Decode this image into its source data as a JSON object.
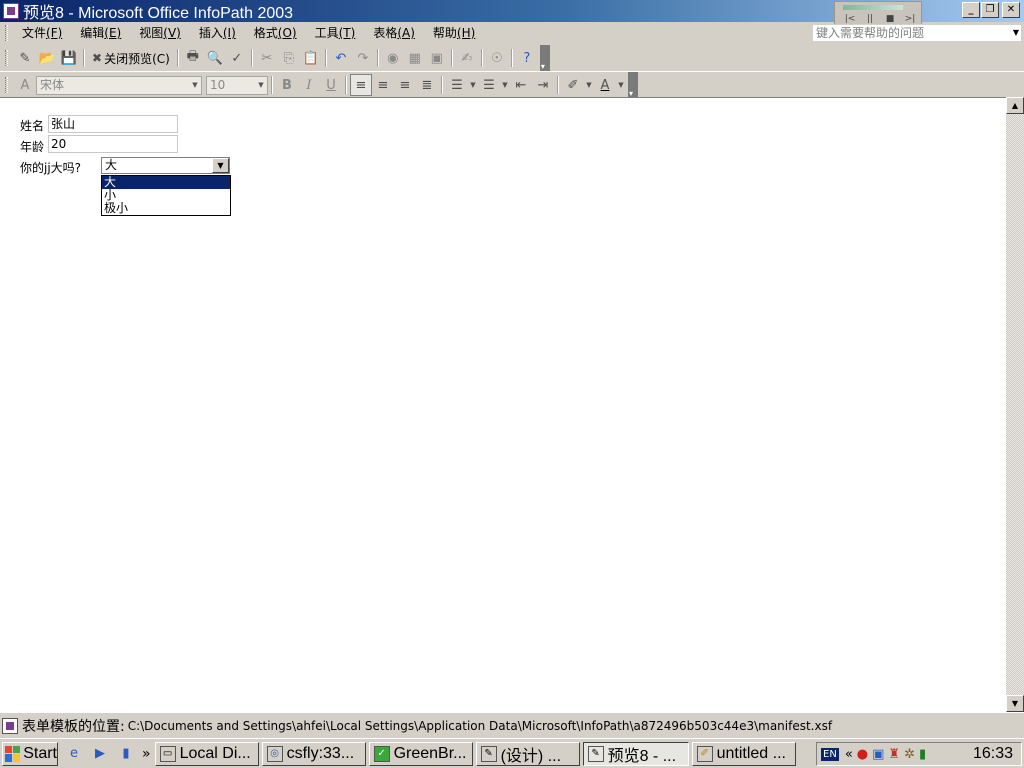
{
  "window": {
    "title": "预览8 - Microsoft Office InfoPath 2003",
    "minimize": "_",
    "restore": "❐",
    "close": "✕"
  },
  "mini_player": {
    "prev": "|<",
    "pause": "||",
    "stop": "■",
    "next": ">|"
  },
  "menubar": {
    "items": [
      {
        "label": "文件",
        "accel": "(F)"
      },
      {
        "label": "编辑",
        "accel": "(E)"
      },
      {
        "label": "视图",
        "accel": "(V)"
      },
      {
        "label": "插入",
        "accel": "(I)"
      },
      {
        "label": "格式",
        "accel": "(O)"
      },
      {
        "label": "工具",
        "accel": "(T)"
      },
      {
        "label": "表格",
        "accel": "(A)"
      },
      {
        "label": "帮助",
        "accel": "(H)"
      }
    ],
    "help_placeholder": "键入需要帮助的问题"
  },
  "toolbar": {
    "close_preview_label": "关闭预览(C)",
    "font_name": "宋体",
    "font_size": "10"
  },
  "form": {
    "name_label": "姓名",
    "name_value": "张山",
    "age_label": "年龄",
    "age_value": "20",
    "question_label": "你的jj大吗?",
    "selected_value": "大",
    "options": [
      "大",
      "小",
      "极小"
    ]
  },
  "statusbar": {
    "label": "表单模板的位置:",
    "path": "C:\\Documents and Settings\\ahfei\\Local Settings\\Application Data\\Microsoft\\InfoPath\\a872496b503c44e3\\manifest.xsf"
  },
  "taskbar": {
    "start_label": "Start",
    "more": "»",
    "tasks": [
      {
        "label": "Local Di...",
        "icon": "drive-icon"
      },
      {
        "label": "csfly:33...",
        "icon": "network-icon"
      },
      {
        "label": "GreenBr...",
        "icon": "browser-icon"
      },
      {
        "label": "(设计) ...",
        "icon": "infopath-icon"
      },
      {
        "label": "预览8 - ...",
        "icon": "infopath-icon"
      },
      {
        "label": "untitled ...",
        "icon": "paint-icon"
      }
    ],
    "lang": "EN",
    "tray_expand": "«",
    "clock": "16:33"
  },
  "colors": {
    "title_gradient_start": "#0a246a",
    "title_gradient_end": "#a6caf0",
    "selection": "#0a246a",
    "face": "#d4d0c8"
  }
}
